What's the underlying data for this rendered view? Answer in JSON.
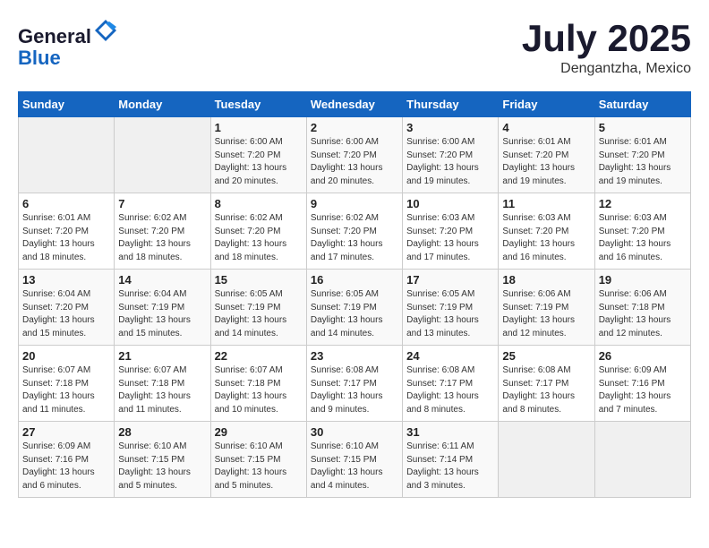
{
  "header": {
    "logo_line1": "General",
    "logo_line2": "Blue",
    "month": "July 2025",
    "location": "Dengantzha, Mexico"
  },
  "weekdays": [
    "Sunday",
    "Monday",
    "Tuesday",
    "Wednesday",
    "Thursday",
    "Friday",
    "Saturday"
  ],
  "weeks": [
    [
      {
        "day": "",
        "info": ""
      },
      {
        "day": "",
        "info": ""
      },
      {
        "day": "1",
        "info": "Sunrise: 6:00 AM\nSunset: 7:20 PM\nDaylight: 13 hours and 20 minutes."
      },
      {
        "day": "2",
        "info": "Sunrise: 6:00 AM\nSunset: 7:20 PM\nDaylight: 13 hours and 20 minutes."
      },
      {
        "day": "3",
        "info": "Sunrise: 6:00 AM\nSunset: 7:20 PM\nDaylight: 13 hours and 19 minutes."
      },
      {
        "day": "4",
        "info": "Sunrise: 6:01 AM\nSunset: 7:20 PM\nDaylight: 13 hours and 19 minutes."
      },
      {
        "day": "5",
        "info": "Sunrise: 6:01 AM\nSunset: 7:20 PM\nDaylight: 13 hours and 19 minutes."
      }
    ],
    [
      {
        "day": "6",
        "info": "Sunrise: 6:01 AM\nSunset: 7:20 PM\nDaylight: 13 hours and 18 minutes."
      },
      {
        "day": "7",
        "info": "Sunrise: 6:02 AM\nSunset: 7:20 PM\nDaylight: 13 hours and 18 minutes."
      },
      {
        "day": "8",
        "info": "Sunrise: 6:02 AM\nSunset: 7:20 PM\nDaylight: 13 hours and 18 minutes."
      },
      {
        "day": "9",
        "info": "Sunrise: 6:02 AM\nSunset: 7:20 PM\nDaylight: 13 hours and 17 minutes."
      },
      {
        "day": "10",
        "info": "Sunrise: 6:03 AM\nSunset: 7:20 PM\nDaylight: 13 hours and 17 minutes."
      },
      {
        "day": "11",
        "info": "Sunrise: 6:03 AM\nSunset: 7:20 PM\nDaylight: 13 hours and 16 minutes."
      },
      {
        "day": "12",
        "info": "Sunrise: 6:03 AM\nSunset: 7:20 PM\nDaylight: 13 hours and 16 minutes."
      }
    ],
    [
      {
        "day": "13",
        "info": "Sunrise: 6:04 AM\nSunset: 7:20 PM\nDaylight: 13 hours and 15 minutes."
      },
      {
        "day": "14",
        "info": "Sunrise: 6:04 AM\nSunset: 7:19 PM\nDaylight: 13 hours and 15 minutes."
      },
      {
        "day": "15",
        "info": "Sunrise: 6:05 AM\nSunset: 7:19 PM\nDaylight: 13 hours and 14 minutes."
      },
      {
        "day": "16",
        "info": "Sunrise: 6:05 AM\nSunset: 7:19 PM\nDaylight: 13 hours and 14 minutes."
      },
      {
        "day": "17",
        "info": "Sunrise: 6:05 AM\nSunset: 7:19 PM\nDaylight: 13 hours and 13 minutes."
      },
      {
        "day": "18",
        "info": "Sunrise: 6:06 AM\nSunset: 7:19 PM\nDaylight: 13 hours and 12 minutes."
      },
      {
        "day": "19",
        "info": "Sunrise: 6:06 AM\nSunset: 7:18 PM\nDaylight: 13 hours and 12 minutes."
      }
    ],
    [
      {
        "day": "20",
        "info": "Sunrise: 6:07 AM\nSunset: 7:18 PM\nDaylight: 13 hours and 11 minutes."
      },
      {
        "day": "21",
        "info": "Sunrise: 6:07 AM\nSunset: 7:18 PM\nDaylight: 13 hours and 11 minutes."
      },
      {
        "day": "22",
        "info": "Sunrise: 6:07 AM\nSunset: 7:18 PM\nDaylight: 13 hours and 10 minutes."
      },
      {
        "day": "23",
        "info": "Sunrise: 6:08 AM\nSunset: 7:17 PM\nDaylight: 13 hours and 9 minutes."
      },
      {
        "day": "24",
        "info": "Sunrise: 6:08 AM\nSunset: 7:17 PM\nDaylight: 13 hours and 8 minutes."
      },
      {
        "day": "25",
        "info": "Sunrise: 6:08 AM\nSunset: 7:17 PM\nDaylight: 13 hours and 8 minutes."
      },
      {
        "day": "26",
        "info": "Sunrise: 6:09 AM\nSunset: 7:16 PM\nDaylight: 13 hours and 7 minutes."
      }
    ],
    [
      {
        "day": "27",
        "info": "Sunrise: 6:09 AM\nSunset: 7:16 PM\nDaylight: 13 hours and 6 minutes."
      },
      {
        "day": "28",
        "info": "Sunrise: 6:10 AM\nSunset: 7:15 PM\nDaylight: 13 hours and 5 minutes."
      },
      {
        "day": "29",
        "info": "Sunrise: 6:10 AM\nSunset: 7:15 PM\nDaylight: 13 hours and 5 minutes."
      },
      {
        "day": "30",
        "info": "Sunrise: 6:10 AM\nSunset: 7:15 PM\nDaylight: 13 hours and 4 minutes."
      },
      {
        "day": "31",
        "info": "Sunrise: 6:11 AM\nSunset: 7:14 PM\nDaylight: 13 hours and 3 minutes."
      },
      {
        "day": "",
        "info": ""
      },
      {
        "day": "",
        "info": ""
      }
    ]
  ]
}
